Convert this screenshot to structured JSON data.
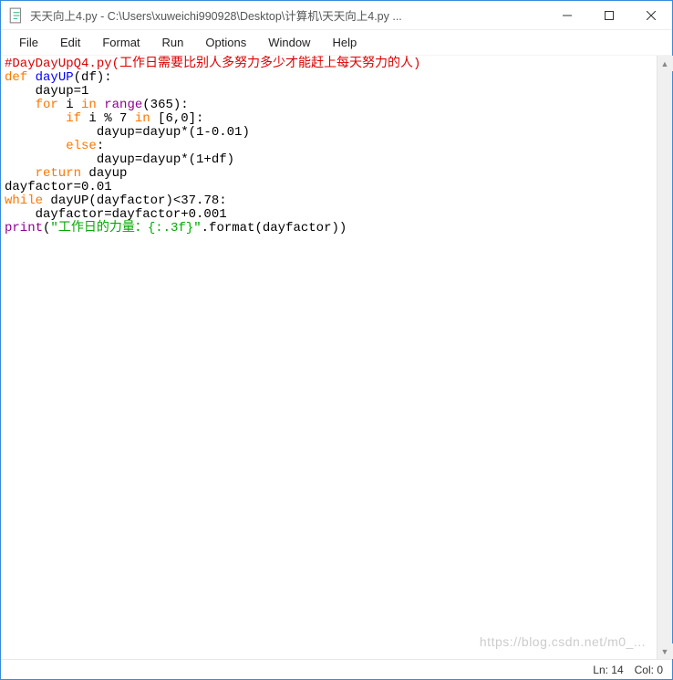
{
  "window": {
    "title": "天天向上4.py - C:\\Users\\xuweichi990928\\Desktop\\计算机\\天天向上4.py ..."
  },
  "menu": {
    "file": "File",
    "edit": "Edit",
    "format": "Format",
    "run": "Run",
    "options": "Options",
    "window": "Window",
    "help": "Help"
  },
  "code": {
    "l1_comment": "#DayDayUpQ4.py(工作日需要比别人多努力多少才能赶上每天努力的人)",
    "l2_def": "def",
    "l2_name": " dayUP",
    "l2_rest": "(df):",
    "l3": "    dayup=1",
    "l4_for": "    for",
    "l4_mid": " i ",
    "l4_in": "in",
    "l4_sp": " ",
    "l4_range": "range",
    "l4_tail": "(365):",
    "l5_if": "        if",
    "l5_mid": " i % 7 ",
    "l5_in": "in",
    "l5_tail": " [6,0]:",
    "l6": "            dayup=dayup*(1-0.01)",
    "l7_else": "        else",
    "l7_tail": ":",
    "l8": "            dayup=dayup*(1+df)",
    "l9_ret": "    return",
    "l9_tail": " dayup",
    "l10": "dayfactor=0.01",
    "l11_while": "while",
    "l11_tail": " dayUP(dayfactor)<37.78:",
    "l12": "    dayfactor=dayfactor+0.001",
    "l13_print": "print",
    "l13_a": "(",
    "l13_str": "\"工作日的力量：{:.3f}\"",
    "l13_b": ".format(dayfactor))"
  },
  "status": {
    "ln": "Ln: 14",
    "col": "Col: 0"
  },
  "watermark": "https://blog.csdn.net/m0_..."
}
